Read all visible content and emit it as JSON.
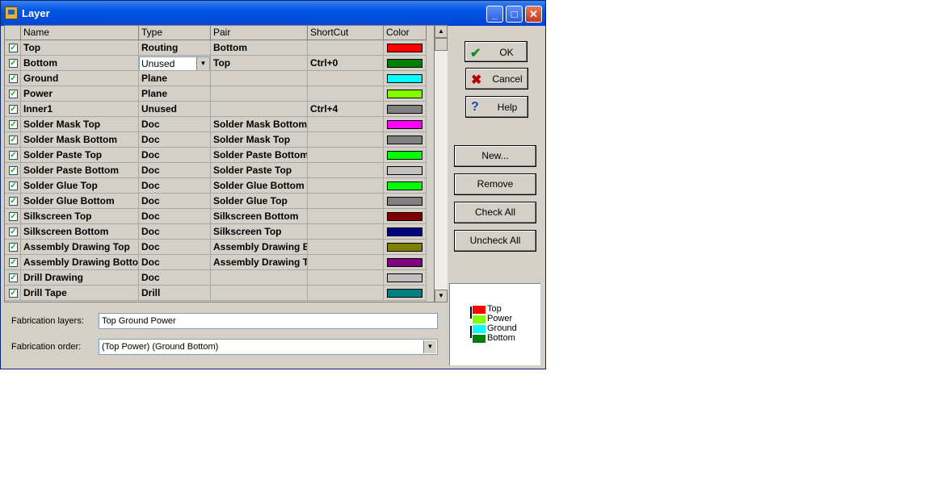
{
  "window": {
    "title": "Layer"
  },
  "columns": [
    "Name",
    "Type",
    "Pair",
    "ShortCut",
    "Color"
  ],
  "rows": [
    {
      "name": "Top",
      "type": "Routing",
      "pair": "Bottom",
      "shortcut": "",
      "color": "#ff0000"
    },
    {
      "name": "Bottom",
      "type": "Unused",
      "pair": "Top",
      "shortcut": "Ctrl+0",
      "color": "#008000",
      "editing": true
    },
    {
      "name": "Ground",
      "type": "Plane",
      "pair": "",
      "shortcut": "",
      "color": "#00ffff"
    },
    {
      "name": "Power",
      "type": "Plane",
      "pair": "",
      "shortcut": "",
      "color": "#80ff00"
    },
    {
      "name": "Inner1",
      "type": "Unused",
      "pair": "",
      "shortcut": "Ctrl+4",
      "color": "#808080"
    },
    {
      "name": "Solder Mask Top",
      "type": "Doc",
      "pair": "Solder Mask Bottom",
      "shortcut": "",
      "color": "#ff00ff"
    },
    {
      "name": "Solder Mask Bottom",
      "type": "Doc",
      "pair": "Solder Mask Top",
      "shortcut": "",
      "color": "#808080"
    },
    {
      "name": "Solder Paste Top",
      "type": "Doc",
      "pair": "Solder Paste Bottom",
      "shortcut": "",
      "color": "#00ff00"
    },
    {
      "name": "Solder Paste Bottom",
      "type": "Doc",
      "pair": "Solder Paste Top",
      "shortcut": "",
      "color": "#c0c0c0"
    },
    {
      "name": "Solder Glue Top",
      "type": "Doc",
      "pair": "Solder Glue Bottom",
      "shortcut": "",
      "color": "#00ff00"
    },
    {
      "name": "Solder Glue Bottom",
      "type": "Doc",
      "pair": "Solder Glue Top",
      "shortcut": "",
      "color": "#808080"
    },
    {
      "name": "Silkscreen Top",
      "type": "Doc",
      "pair": "Silkscreen Bottom",
      "shortcut": "",
      "color": "#800000"
    },
    {
      "name": "Silkscreen Bottom",
      "type": "Doc",
      "pair": "Silkscreen Top",
      "shortcut": "",
      "color": "#000080"
    },
    {
      "name": "Assembly Drawing Top",
      "type": "Doc",
      "pair": "Assembly Drawing Bo",
      "shortcut": "",
      "color": "#808000"
    },
    {
      "name": "Assembly Drawing Bottom",
      "type": "Doc",
      "pair": "Assembly Drawing To",
      "shortcut": "",
      "color": "#800080"
    },
    {
      "name": "Drill Drawing",
      "type": "Doc",
      "pair": "",
      "shortcut": "",
      "color": "#c0c0c0"
    },
    {
      "name": "Drill Tape",
      "type": "Drill",
      "pair": "",
      "shortcut": "",
      "color": "#008080"
    }
  ],
  "fabrication": {
    "layers_label": "Fabrication layers:",
    "layers_value": "Top Ground Power",
    "order_label": "Fabrication order:",
    "order_value": "(Top Power) (Ground Bottom)"
  },
  "buttons": {
    "ok": "OK",
    "cancel": "Cancel",
    "help": "Help",
    "new": "New...",
    "remove": "Remove",
    "check_all": "Check All",
    "uncheck_all": "Uncheck All"
  },
  "preview": [
    {
      "label": "Top",
      "color": "#ff0000"
    },
    {
      "label": "Power",
      "color": "#80ff00"
    },
    {
      "label": "Ground",
      "color": "#00ffff"
    },
    {
      "label": "Bottom",
      "color": "#008000"
    }
  ]
}
